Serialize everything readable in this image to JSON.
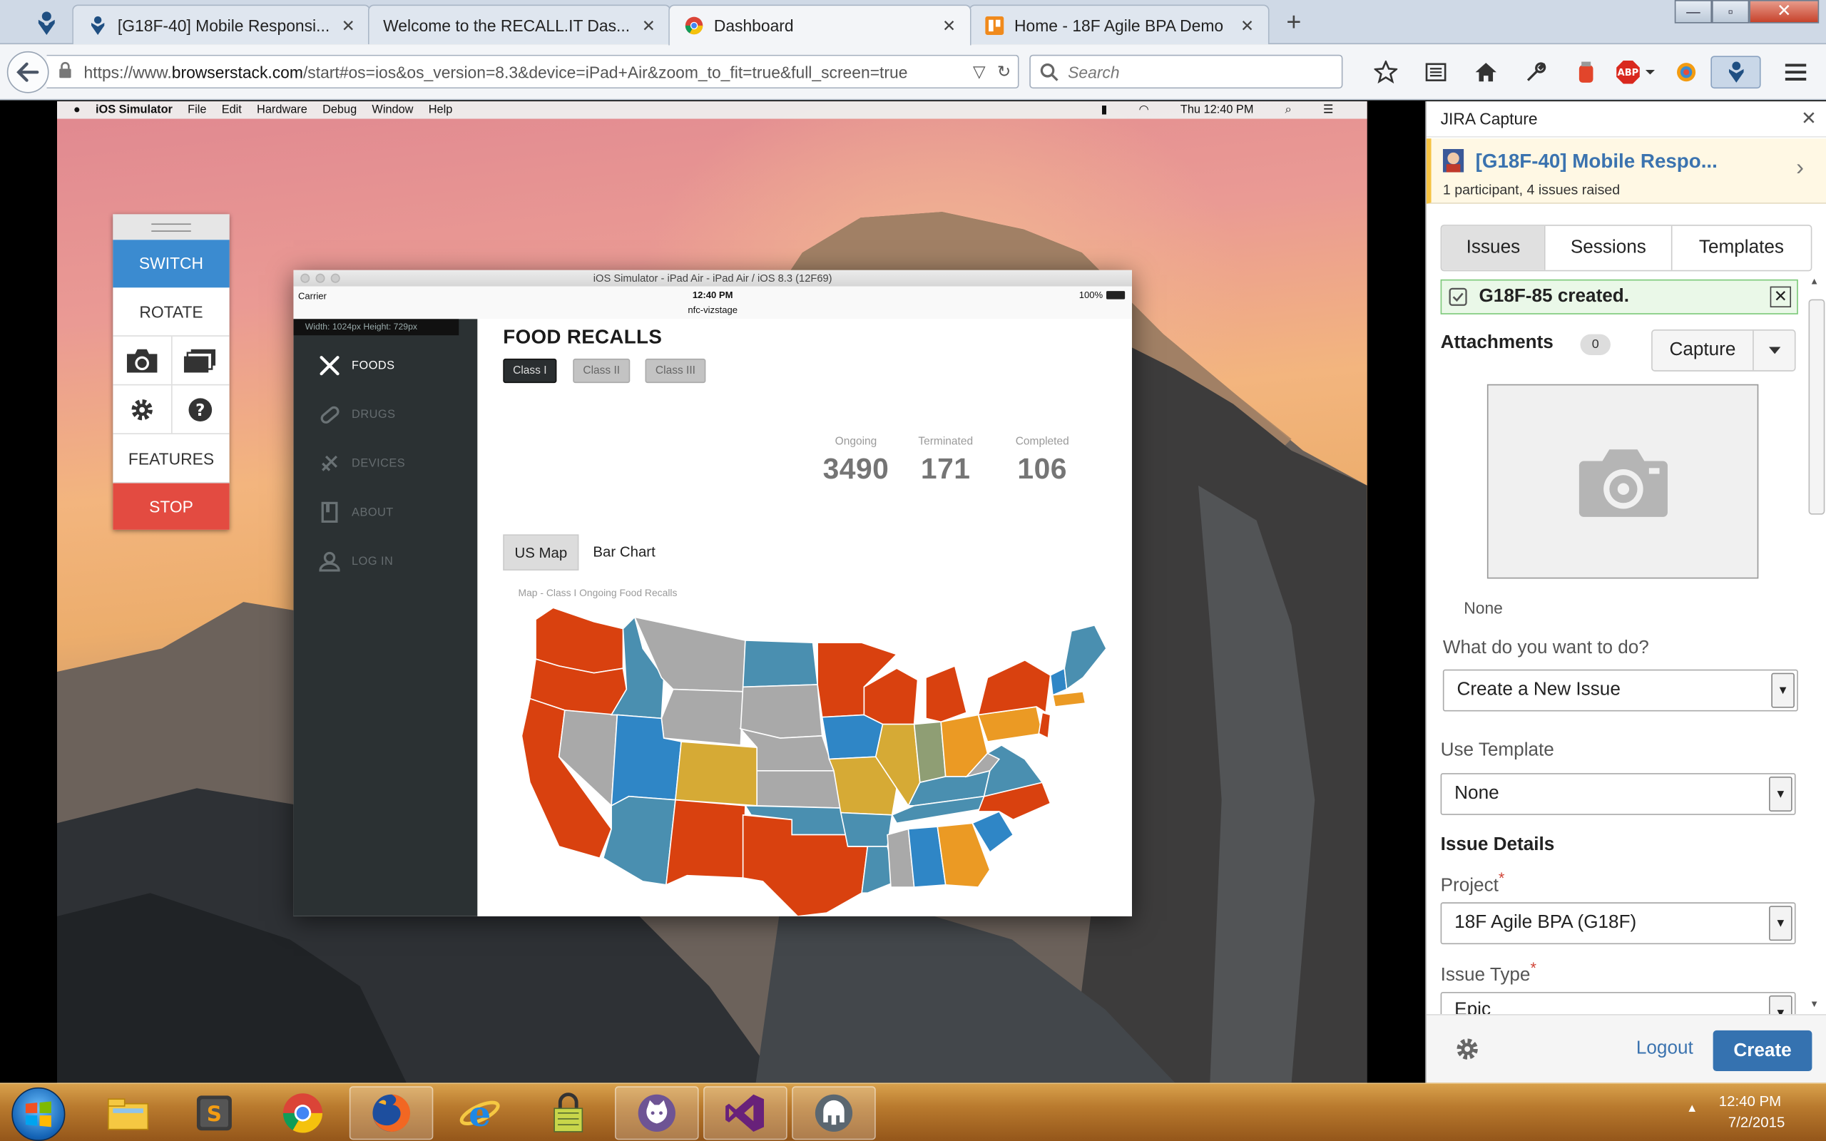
{
  "browser": {
    "tabs": [
      {
        "title": "[G18F-40] Mobile Responsi...",
        "icon": "jira-icon"
      },
      {
        "title": "Welcome to the RECALL.IT Das...",
        "icon": "none"
      },
      {
        "title": "Dashboard",
        "icon": "chrome-icon",
        "active": true
      },
      {
        "title": "Home - 18F Agile BPA Demo",
        "icon": "github-pages-icon"
      }
    ],
    "url_prefix": "https://www.",
    "url_domain": "browserstack.com",
    "url_rest": "/start#os=ios&os_version=8.3&device=iPad+Air&zoom_to_fit=true&full_screen=true",
    "search_placeholder": "Search"
  },
  "mac_menu": {
    "items": [
      "iOS Simulator",
      "File",
      "Edit",
      "Hardware",
      "Debug",
      "Window",
      "Help"
    ],
    "clock": "Thu 12:40 PM"
  },
  "bs_panel": {
    "switch": "SWITCH",
    "rotate": "ROTATE",
    "features": "FEATURES",
    "stop": "STOP"
  },
  "simulator": {
    "window_title": "iOS Simulator - iPad Air - iPad Air / iOS 8.3 (12F69)",
    "carrier": "Carrier",
    "time": "12:40 PM",
    "site": "nfc-vizstage",
    "battery": "100%",
    "dims": "Width: 1024px    Height: 729px"
  },
  "app": {
    "nav": [
      {
        "label": "FOODS",
        "icon": "fork-knife-icon",
        "active": true
      },
      {
        "label": "DRUGS",
        "icon": "pill-icon"
      },
      {
        "label": "DEVICES",
        "icon": "device-icon"
      },
      {
        "label": "ABOUT",
        "icon": "book-icon"
      },
      {
        "label": "LOG IN",
        "icon": "user-icon"
      }
    ],
    "title": "FOOD RECALLS",
    "classes": [
      "Class I",
      "Class II",
      "Class III"
    ],
    "stats": [
      {
        "label": "Ongoing",
        "value": "3490"
      },
      {
        "label": "Terminated",
        "value": "171"
      },
      {
        "label": "Completed",
        "value": "106"
      }
    ],
    "view_tabs": [
      "US Map",
      "Bar Chart"
    ],
    "map_title": "Map - Class I Ongoing Food Recalls",
    "map_colors": {
      "red": "#d9410f",
      "blue": "#4a8fb0",
      "lightblue": "#2f86c6",
      "gray": "#a9a9a9",
      "gold": "#d6aa35",
      "orange": "#eb9a24",
      "olive": "#8f9e74"
    }
  },
  "jira": {
    "panel_title": "JIRA Capture",
    "session_title": "[G18F-40] Mobile Respo...",
    "session_sub": "1 participant, 4 issues raised",
    "tabs": [
      "Issues",
      "Sessions",
      "Templates"
    ],
    "notice": "G18F-85 created.",
    "attachments_label": "Attachments",
    "attachments_count": "0",
    "capture": "Capture",
    "none_label": "None",
    "what_label": "What do you want to do?",
    "what_value": "Create a New Issue",
    "template_label": "Use Template",
    "template_value": "None",
    "details_label": "Issue Details",
    "project_label": "Project",
    "project_value": "18F Agile BPA (G18F)",
    "issuetype_label": "Issue Type",
    "issuetype_value": "Epic",
    "logout": "Logout",
    "create": "Create"
  },
  "taskbar": {
    "apps": [
      "explorer-icon",
      "sublime-icon",
      "chrome-icon",
      "firefox-icon",
      "ie-icon",
      "keepass-icon",
      "github-icon",
      "visual-studio-icon",
      "elephant-icon"
    ],
    "time": "12:40 PM",
    "date": "7/2/2015"
  }
}
